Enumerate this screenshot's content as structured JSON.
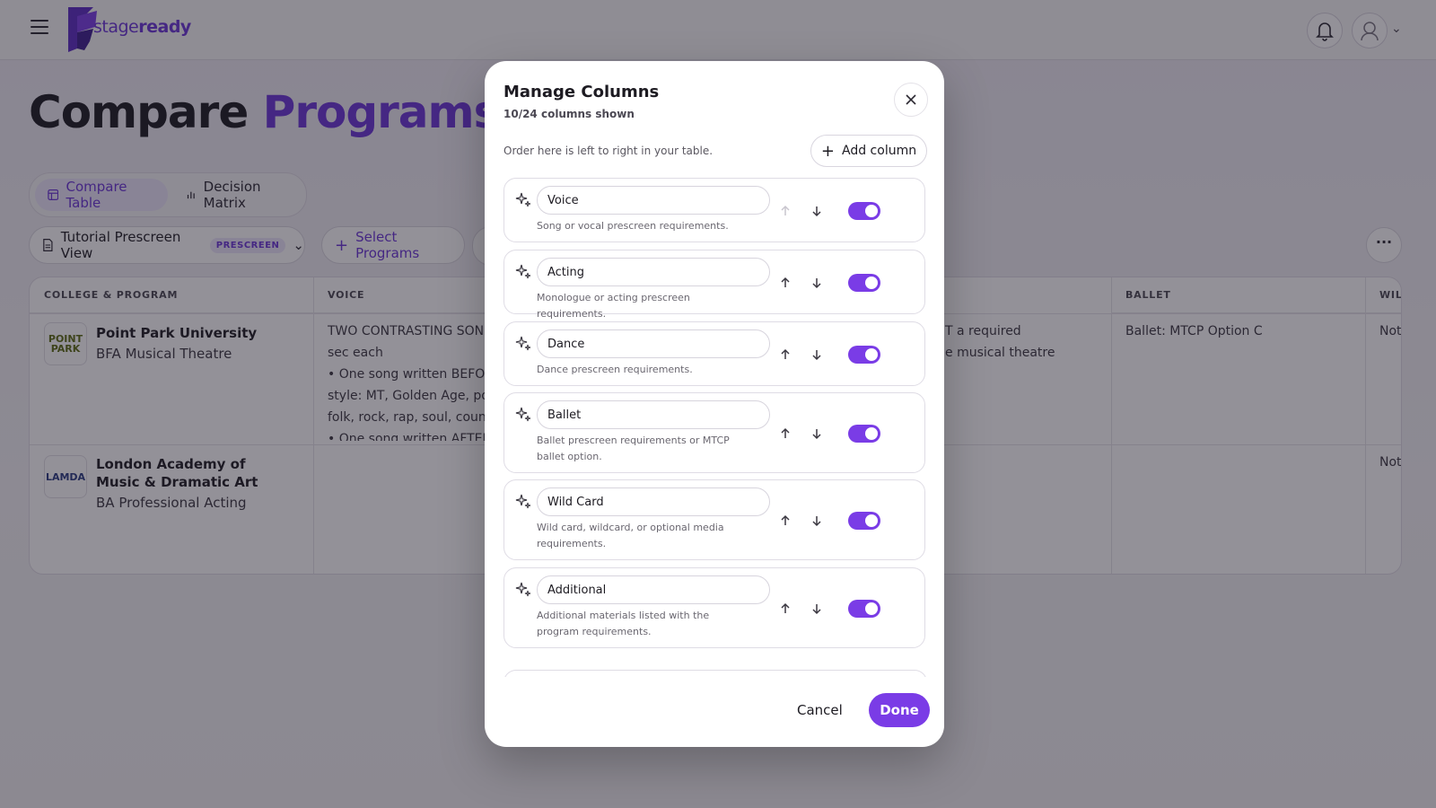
{
  "header": {
    "logo_text_a": "stage",
    "logo_text_b": "ready"
  },
  "page": {
    "title_a": "Compare",
    "title_b": "Programs",
    "tabs": [
      {
        "label": "Compare Table"
      },
      {
        "label": "Decision Matrix"
      }
    ],
    "view": {
      "label": "Tutorial Prescreen View",
      "badge": "PRESCREEN"
    },
    "select_programs": "Select Programs"
  },
  "table": {
    "headers": [
      "COLLEGE & PROGRAM",
      "VOICE",
      "BALLET",
      "WILD C"
    ],
    "rows": [
      {
        "logo": "POINT PARK",
        "college": "Point Park University",
        "program": "BFA Musical Theatre",
        "voice": [
          "TWO CONTRASTING SON",
          "sec each",
          "• One song written BEFOR",
          "style: MT, Golden Age, pop",
          "folk, rock, rap, soul, countr",
          "• One song written AFTER"
        ],
        "dance_partial": [
          "T a required",
          "e musical theatre"
        ],
        "ballet": "Ballet: MTCP Option C",
        "wild": "Not re"
      },
      {
        "logo": "LAMDA",
        "college": "London Academy of Music & Dramatic Art",
        "program": "BA Professional Acting",
        "wild": "Not re"
      }
    ]
  },
  "modal": {
    "title": "Manage Columns",
    "subtitle": "10/24 columns shown",
    "order_hint": "Order here is left to right in your table.",
    "add_column": "Add column",
    "columns": [
      {
        "name": "Voice",
        "desc": "Song or vocal prescreen requirements.",
        "enabled": true
      },
      {
        "name": "Acting",
        "desc": "Monologue or acting prescreen requirements.",
        "enabled": true
      },
      {
        "name": "Dance",
        "desc": "Dance prescreen requirements.",
        "enabled": true
      },
      {
        "name": "Ballet",
        "desc": "Ballet prescreen requirements or MTCP ballet option.",
        "enabled": true
      },
      {
        "name": "Wild Card",
        "desc": "Wild card, wildcard, or optional media requirements.",
        "enabled": true
      },
      {
        "name": "Additional",
        "desc": "Additional materials listed with the program requirements.",
        "enabled": true
      }
    ],
    "cancel": "Cancel",
    "done": "Done"
  },
  "colors": {
    "accent": "#7a3ce6",
    "brand": "#6a35d6"
  }
}
